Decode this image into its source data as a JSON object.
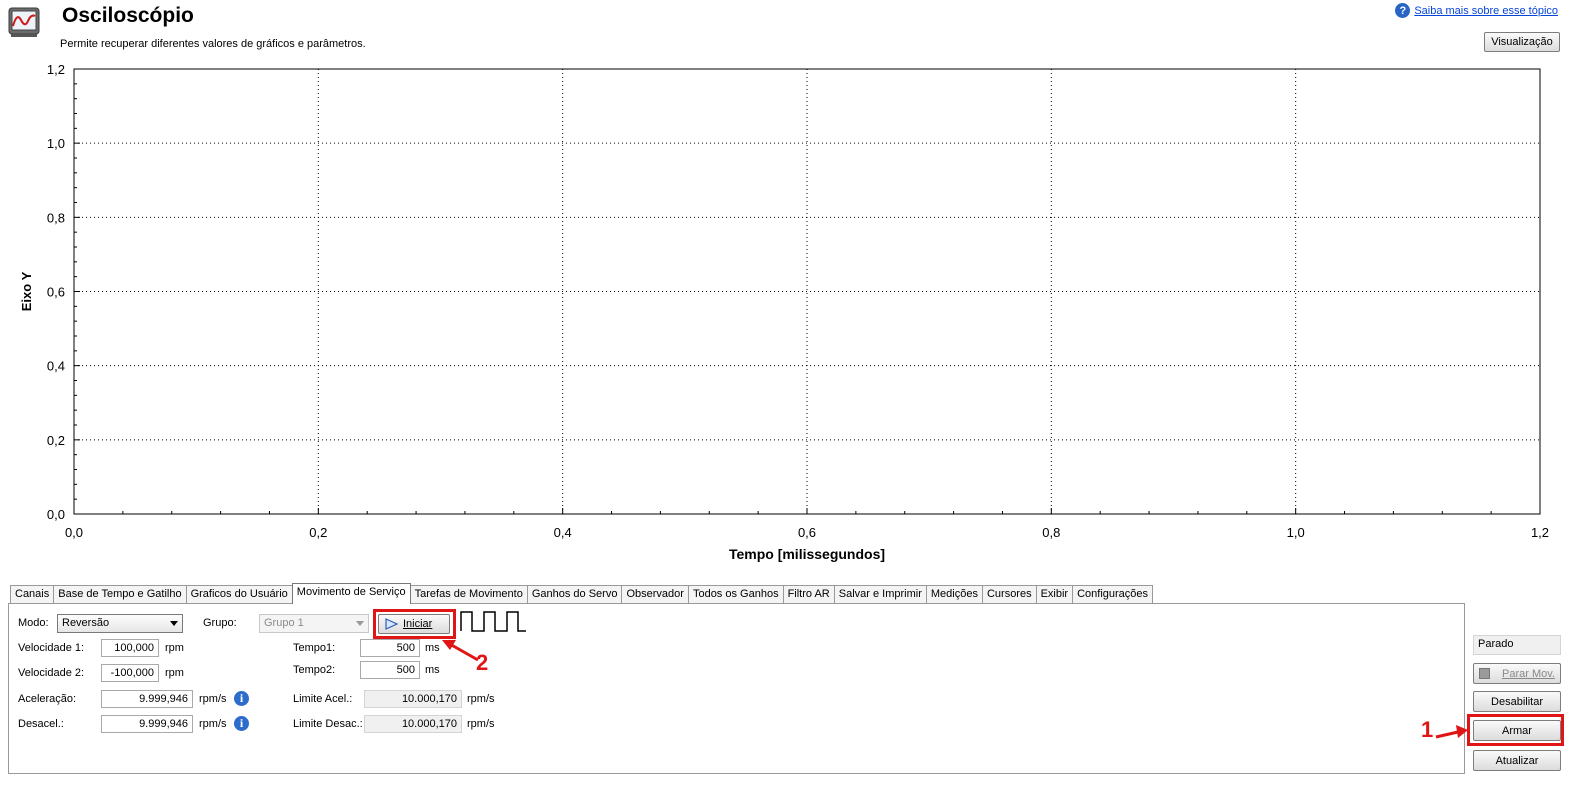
{
  "header": {
    "title": "Osciloscópio",
    "subtitle": "Permite recuperar diferentes valores de gráficos e parâmetros.",
    "help_link": "Saiba mais sobre esse tópico",
    "view_button": "Visualização"
  },
  "chart_data": {
    "type": "line",
    "title": "",
    "xlabel": "Tempo [milissegundos]",
    "ylabel": "Eixo Y",
    "xlim": [
      0,
      1.2
    ],
    "ylim": [
      0,
      1.2
    ],
    "x_ticks": [
      "0,0",
      "0,2",
      "0,4",
      "0,6",
      "0,8",
      "1,0",
      "1,2"
    ],
    "y_ticks": [
      "0,0",
      "0,2",
      "0,4",
      "0,6",
      "0,8",
      "1,0",
      "1,2"
    ],
    "grid": true,
    "series": []
  },
  "tabs": [
    {
      "label": "Canais",
      "active": false
    },
    {
      "label": "Base de Tempo e Gatilho",
      "active": false
    },
    {
      "label": "Graficos do Usuário",
      "active": false
    },
    {
      "label": "Movimento de Serviço",
      "active": true
    },
    {
      "label": "Tarefas de Movimento",
      "active": false
    },
    {
      "label": "Ganhos do Servo",
      "active": false
    },
    {
      "label": "Observador",
      "active": false
    },
    {
      "label": "Todos os Ganhos",
      "active": false
    },
    {
      "label": "Filtro AR",
      "active": false
    },
    {
      "label": "Salvar e Imprimir",
      "active": false
    },
    {
      "label": "Medições",
      "active": false
    },
    {
      "label": "Cursores",
      "active": false
    },
    {
      "label": "Exibir",
      "active": false
    },
    {
      "label": "Configurações",
      "active": false
    }
  ],
  "service": {
    "mode_label": "Modo:",
    "mode_value": "Reversão",
    "group_label": "Grupo:",
    "group_value": "Grupo 1",
    "start_button": "Iniciar",
    "vel1_label": "Velocidade 1:",
    "vel1_value": "100,000",
    "vel2_label": "Velocidade 2:",
    "vel2_value": "-100,000",
    "rpm_unit": "rpm",
    "accel_label": "Aceleração:",
    "accel_value": "9.999,946",
    "decel_label": "Desacel.:",
    "decel_value": "9.999,946",
    "rpms_unit": "rpm/s",
    "time1_label": "Tempo1:",
    "time1_value": "500",
    "time2_label": "Tempo2:",
    "time2_value": "500",
    "ms_unit": "ms",
    "accel_limit_label": "Limite Acel.:",
    "accel_limit_value": "10.000,170",
    "decel_limit_label": "Limite Desac.:",
    "decel_limit_value": "10.000,170"
  },
  "right_panel": {
    "status": "Parado",
    "stop_motion": "Parar Mov.",
    "disable": "Desabilitar",
    "arm": "Armar",
    "refresh": "Atualizar"
  },
  "annotations": {
    "callout_1": "1",
    "callout_2": "2",
    "color": "#e01515"
  }
}
